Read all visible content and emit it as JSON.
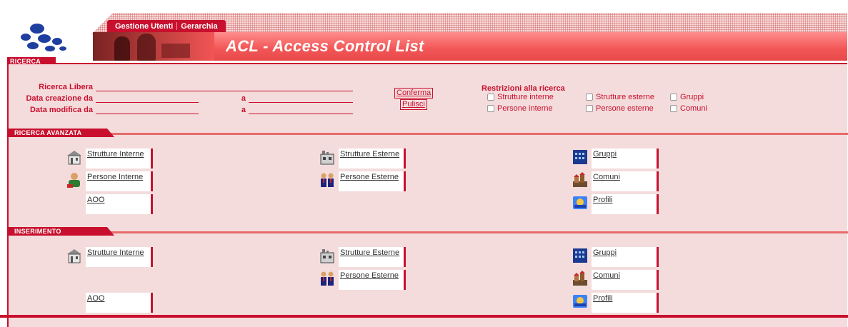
{
  "header": {
    "nav": [
      "Gestione Utenti",
      "Gerarchia"
    ],
    "title": "ACL - Access Control List",
    "section_tab": "RICERCA"
  },
  "search": {
    "free_label": "Ricerca Libera",
    "created_label": "Data creazione da",
    "modified_label": "Data modifica da",
    "to_label": "a",
    "confirm_button": "Conferma",
    "clear_button": "Pulisci",
    "restrictions_title": "Restrizioni alla ricerca",
    "restrictions": [
      "Strutture interne",
      "Strutture esterne",
      "Gruppi",
      "Persone interne",
      "Persone esterne",
      "Comuni"
    ]
  },
  "advanced": {
    "title": "RICERCA AVANZATA",
    "items": [
      "Strutture Interne",
      "Persone Interne",
      "AOO",
      "Strutture Esterne",
      "Persone Esterne",
      "Gruppi",
      "Comuni",
      "Profili"
    ]
  },
  "insert": {
    "title": "INSERIMENTO",
    "items": [
      "Strutture Interne",
      "AOO",
      "Strutture Esterne",
      "Persone Esterne",
      "Gruppi",
      "Comuni",
      "Profili"
    ]
  },
  "colors": {
    "accent": "#c8102e",
    "panel": "#f4dcdc",
    "banner": "#f25555"
  },
  "icons": [
    "logo",
    "building-icon",
    "factory-icon",
    "person-icon",
    "people-icon",
    "group-icon",
    "town-icon",
    "profile-icon"
  ]
}
